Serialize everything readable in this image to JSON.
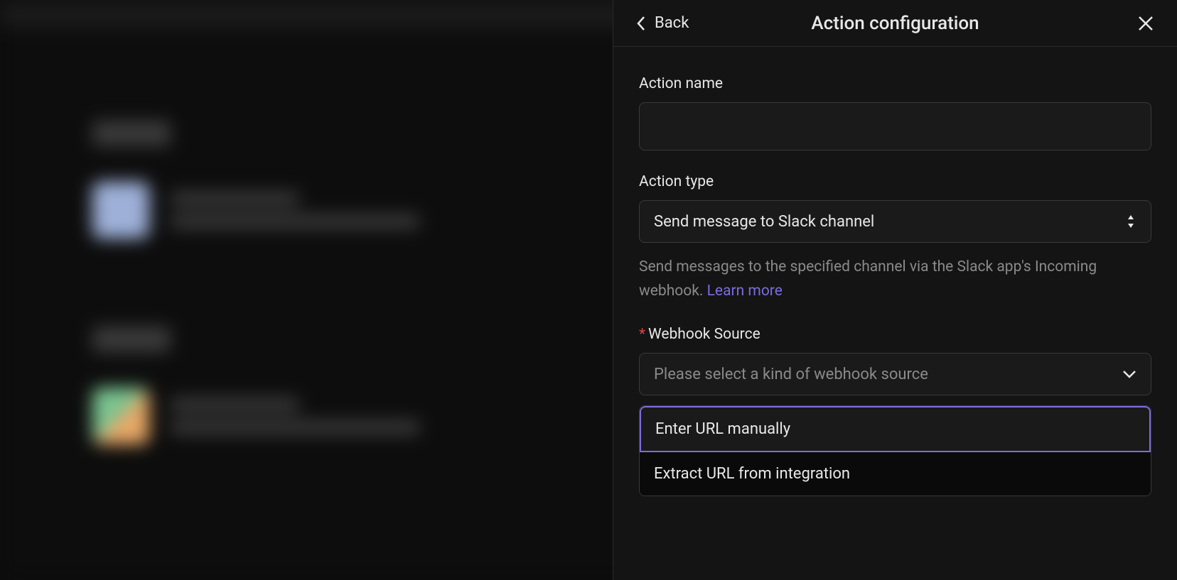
{
  "header": {
    "back_label": "Back",
    "title": "Action configuration"
  },
  "fields": {
    "action_name": {
      "label": "Action name",
      "value": ""
    },
    "action_type": {
      "label": "Action type",
      "value": "Send message to Slack channel",
      "helper_text": "Send messages to the specified channel via the Slack app's Incoming webhook. ",
      "learn_more": "Learn more"
    },
    "webhook_source": {
      "label": "Webhook Source",
      "placeholder": "Please select a kind of webhook source",
      "options": [
        "Enter URL manually",
        "Extract URL from integration"
      ]
    }
  }
}
